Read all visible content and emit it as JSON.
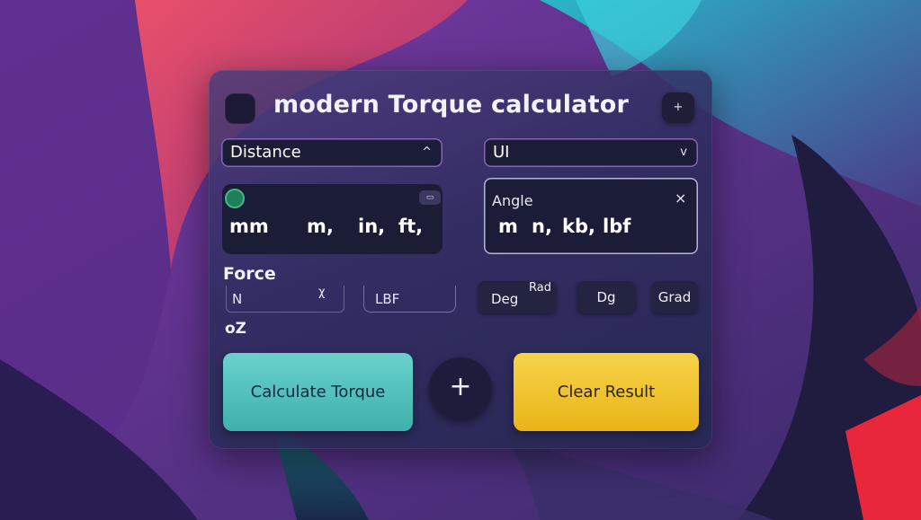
{
  "app": {
    "title": "modern Torque calculator",
    "add_button_symbol": "+"
  },
  "distance_select": {
    "value": "Distance",
    "chevron": "^"
  },
  "unit_select": {
    "value": "UI",
    "chevron": "v"
  },
  "distance_units": {
    "tag": "▭",
    "items": [
      "mm",
      "m,",
      "in,",
      "ft,"
    ]
  },
  "angle_panel": {
    "label": "Angle",
    "close_symbol": "×",
    "items": [
      "m",
      "n,",
      "kb,",
      "lbf"
    ]
  },
  "force": {
    "label": "Force",
    "field_n_value": "N",
    "field_n_marker": "χ",
    "field_lbf_value": "LBF",
    "extra_unit": "oZ"
  },
  "angle_units": {
    "deg_rad_main": "Deg",
    "deg_rad_super": "Rad",
    "deg": "Dg",
    "grad": "Grad"
  },
  "actions": {
    "calculate_label": "Calculate Torque",
    "plus_symbol": "+",
    "clear_label": "Clear Result"
  },
  "colors": {
    "calculate": "#4fc2bd",
    "clear": "#f2c632",
    "panel": "#3c3a70",
    "accent_border": "#8b62b8"
  }
}
